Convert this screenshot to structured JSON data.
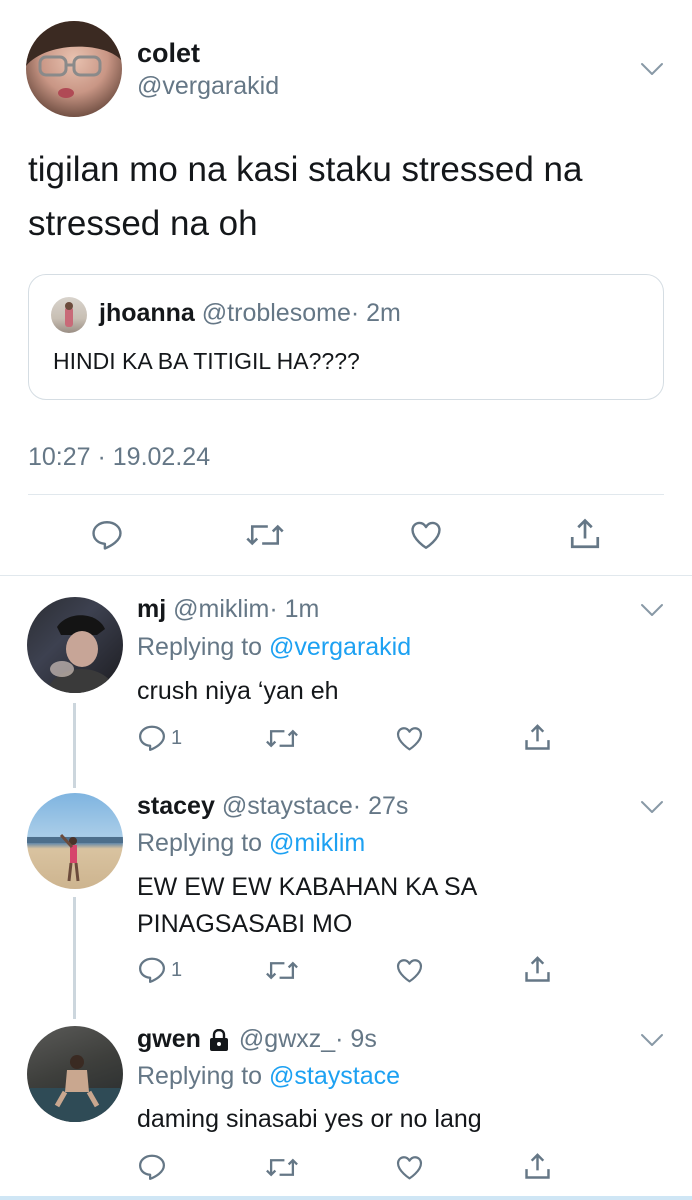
{
  "main_tweet": {
    "name": "colet",
    "handle": "@vergarakid",
    "text_line1": "tigilan mo na kasi staku stressed na",
    "text_line2": "stressed na oh",
    "quote": {
      "name": "jhoanna",
      "handle": "@troblesome",
      "time": "· 2m",
      "text": "HINDI KA BA TITIGIL HA????"
    },
    "timestamp": "10:27 · 19.02.24"
  },
  "replies": [
    {
      "name": "mj",
      "handle": "@miklim",
      "time": "· 1m",
      "replying_prefix": "Replying to",
      "replying_to": "@vergarakid",
      "text_line1": "crush niya ‘yan eh",
      "text_line2": "",
      "reply_count": "1"
    },
    {
      "name": "stacey",
      "handle": "@staystace",
      "time": "· 27s",
      "replying_prefix": "Replying to",
      "replying_to": "@miklim",
      "text_line1": "EW EW EW KABAHAN KA SA",
      "text_line2": "PINAGSASABI MO",
      "reply_count": "1"
    },
    {
      "name": "gwen",
      "handle": "@gwxz_",
      "time": "· 9s",
      "replying_prefix": "Replying to",
      "replying_to": "@staystace",
      "text_line1": "daming sinasabi yes or no lang",
      "text_line2": "",
      "reply_count": ""
    }
  ],
  "colors": {
    "accent": "#1da1f2",
    "muted": "#657786",
    "border": "#e1e8ed"
  },
  "icons": [
    "chevron-down-icon",
    "reply-icon",
    "retweet-icon",
    "like-icon",
    "share-icon",
    "lock-icon"
  ]
}
